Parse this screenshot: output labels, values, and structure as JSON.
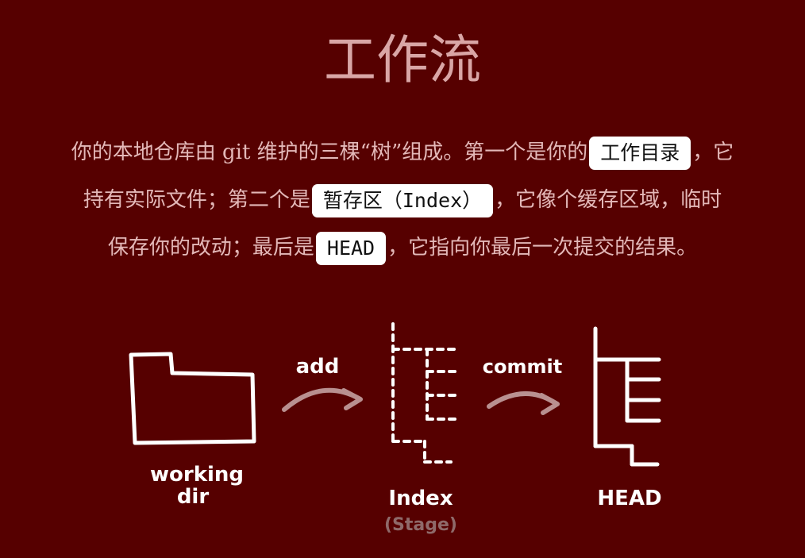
{
  "title": "工作流",
  "paragraph": {
    "line1_a": "你的本地仓库由 git 维护的三棵“树”组成。第一个是你的",
    "tag_working_directory": "工作目录",
    "line1_b": "，它",
    "line2_a": "持有实际文件；第二个是",
    "tag_index": "暂存区（Index）",
    "line2_b": "，它像个缓存区域，临时",
    "line3_a": "保存你的改动；最后是",
    "tag_head": "HEAD",
    "line3_b": "，它指向你最后一次提交的结果。"
  },
  "diagram": {
    "working_label_1": "working",
    "working_label_2": "dir",
    "add_label": "add",
    "index_label": "Index",
    "stage_label": "(Stage)",
    "commit_label": "commit",
    "head_label": "HEAD"
  },
  "colors": {
    "background": "#560000",
    "title": "#d9a6a6",
    "text": "#e3b8b8",
    "sketch": "#ffffff",
    "arrow": "#b99090"
  }
}
